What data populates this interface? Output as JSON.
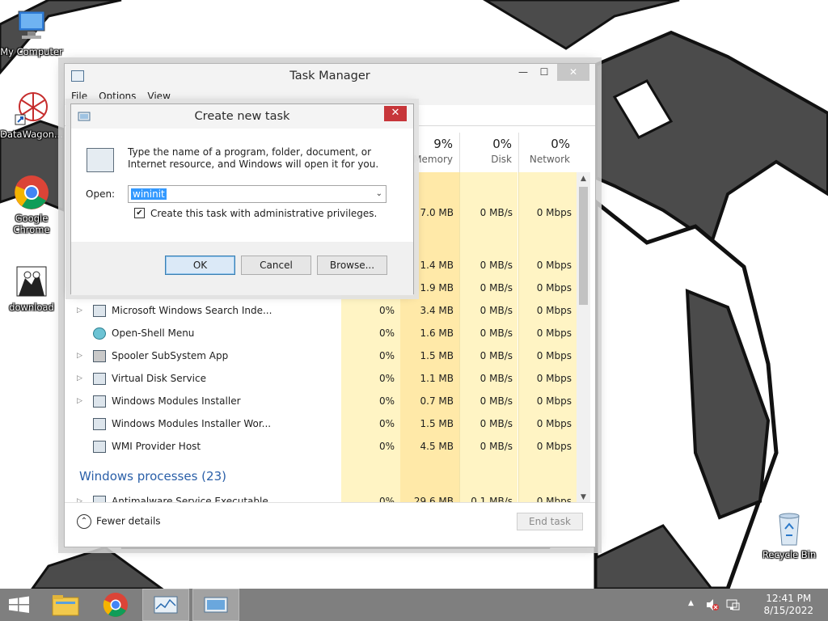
{
  "desktop": {
    "icons": [
      {
        "label": "My Computer",
        "icon": "computer-icon"
      },
      {
        "label": "DataWagon...",
        "icon": "datawagon-icon"
      },
      {
        "label": "Google Chrome",
        "icon": "chrome-icon"
      },
      {
        "label": "download",
        "icon": "download-image-icon"
      },
      {
        "label": "Recycle Bin",
        "icon": "recycle-bin-icon"
      }
    ]
  },
  "task_manager": {
    "title": "Task Manager",
    "menu": [
      "File",
      "Options",
      "View"
    ],
    "window_controls": {
      "minimize": "—",
      "maximize": "☐",
      "close": "✕"
    },
    "columns": [
      {
        "pct": "9%",
        "name": "Memory"
      },
      {
        "pct": "0%",
        "name": "Disk"
      },
      {
        "pct": "0%",
        "name": "Network"
      }
    ],
    "hidden_rows": [
      {
        "memory": "7.0 MB",
        "disk": "0 MB/s",
        "network": "0 Mbps"
      },
      {
        "memory": "1.4 MB",
        "disk": "0 MB/s",
        "network": "0 Mbps"
      },
      {
        "memory": "1.9 MB",
        "disk": "0 MB/s",
        "network": "0 Mbps"
      }
    ],
    "processes": [
      {
        "name": "Microsoft Windows Search Inde...",
        "expandable": true,
        "cpu": "0%",
        "memory": "3.4 MB",
        "disk": "0 MB/s",
        "network": "0 Mbps",
        "icon": "search-indexer-icon"
      },
      {
        "name": "Open-Shell Menu",
        "expandable": false,
        "cpu": "0%",
        "memory": "1.6 MB",
        "disk": "0 MB/s",
        "network": "0 Mbps",
        "icon": "open-shell-icon"
      },
      {
        "name": "Spooler SubSystem App",
        "expandable": true,
        "cpu": "0%",
        "memory": "1.5 MB",
        "disk": "0 MB/s",
        "network": "0 Mbps",
        "icon": "printer-icon"
      },
      {
        "name": "Virtual Disk Service",
        "expandable": true,
        "cpu": "0%",
        "memory": "1.1 MB",
        "disk": "0 MB/s",
        "network": "0 Mbps",
        "icon": "service-icon"
      },
      {
        "name": "Windows Modules Installer",
        "expandable": true,
        "cpu": "0%",
        "memory": "0.7 MB",
        "disk": "0 MB/s",
        "network": "0 Mbps",
        "icon": "service-icon"
      },
      {
        "name": "Windows Modules Installer Wor...",
        "expandable": false,
        "cpu": "0%",
        "memory": "1.5 MB",
        "disk": "0 MB/s",
        "network": "0 Mbps",
        "icon": "service-icon"
      },
      {
        "name": "WMI Provider Host",
        "expandable": false,
        "cpu": "0%",
        "memory": "4.5 MB",
        "disk": "0 MB/s",
        "network": "0 Mbps",
        "icon": "wmi-icon"
      }
    ],
    "group_header": "Windows processes (23)",
    "partial_row": {
      "name": "Antimalware Service Executable",
      "cpu": "0%",
      "memory": "29.6 MB",
      "disk": "0.1 MB/s",
      "network": "0 Mbps"
    },
    "fewer_details": "Fewer details",
    "end_task": "End task"
  },
  "dialog": {
    "title": "Create new task",
    "close": "✕",
    "message": "Type the name of a program, folder, document, or Internet resource, and Windows will open it for you.",
    "open_label": "Open:",
    "open_value": "wininit",
    "admin_checkbox_label": "Create this task with administrative privileges.",
    "admin_checked": true,
    "buttons": {
      "ok": "OK",
      "cancel": "Cancel",
      "browse": "Browse..."
    }
  },
  "taskbar": {
    "items": [
      "start-icon",
      "file-explorer-icon",
      "chrome-icon",
      "task-manager-icon",
      "run-dialog-icon"
    ],
    "tray": {
      "arrow": "▲"
    },
    "clock": {
      "time": "12:41 PM",
      "date": "8/15/2022"
    }
  },
  "colors": {
    "accent": "#2a5fa8",
    "heat_light": "#fff4c4",
    "heat_dark": "#ffe9a8",
    "close_red": "#c7363a",
    "taskbar": "#7f7f7f"
  }
}
